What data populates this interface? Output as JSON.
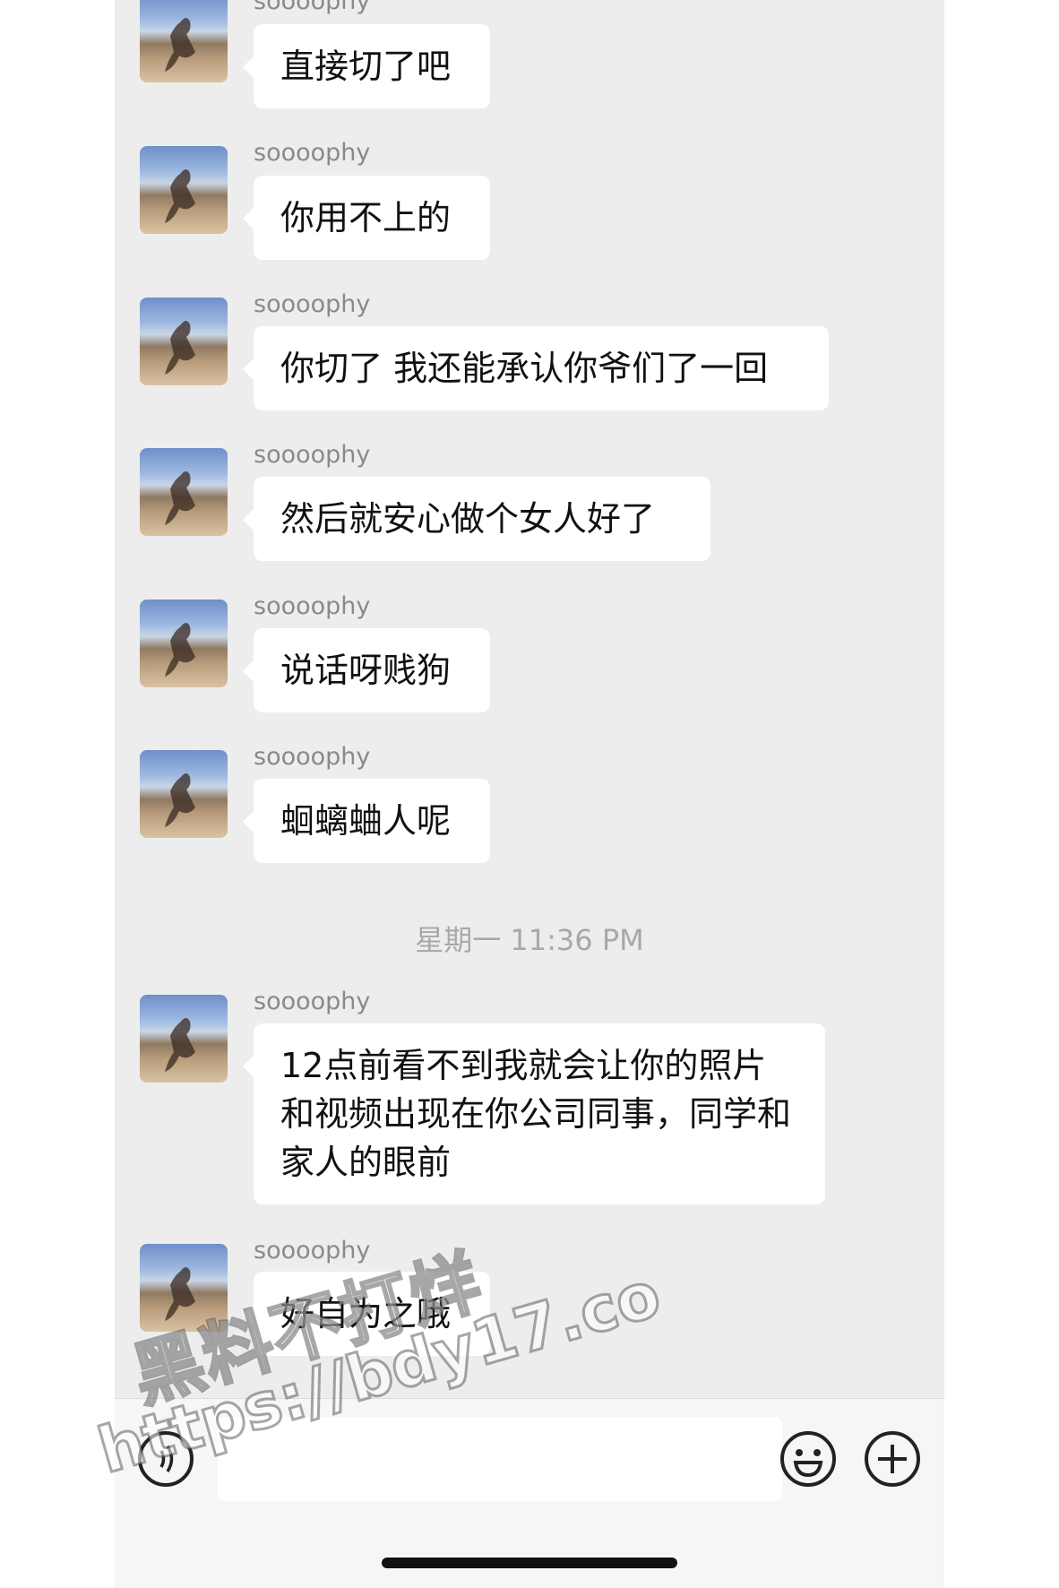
{
  "chat": {
    "messages_top": [
      {
        "sender": "soooophy",
        "text": "直接切了吧"
      },
      {
        "sender": "soooophy",
        "text": "你用不上的"
      },
      {
        "sender": "soooophy",
        "text": "你切了 我还能承认你爷们了一回"
      },
      {
        "sender": "soooophy",
        "text": "然后就安心做个女人好了"
      },
      {
        "sender": "soooophy",
        "text": "说话呀贱狗"
      },
      {
        "sender": "soooophy",
        "text": "蛔螭蛐人呢"
      }
    ],
    "timestamp": "星期一 11:36 PM",
    "messages_bottom": [
      {
        "sender": "soooophy",
        "text": "12点前看不到我就会让你的照片和视频出现在你公司同事，同学和家人的眼前"
      },
      {
        "sender": "soooophy",
        "text": "好自为之哦"
      }
    ]
  },
  "input_bar": {
    "voice_icon": "voice-icon",
    "emoji_icon": "emoji-icon",
    "plus_icon": "plus-icon",
    "text_value": ""
  },
  "watermark": {
    "line1": "黑料不打烊",
    "line2": "https://bdy17.co"
  }
}
